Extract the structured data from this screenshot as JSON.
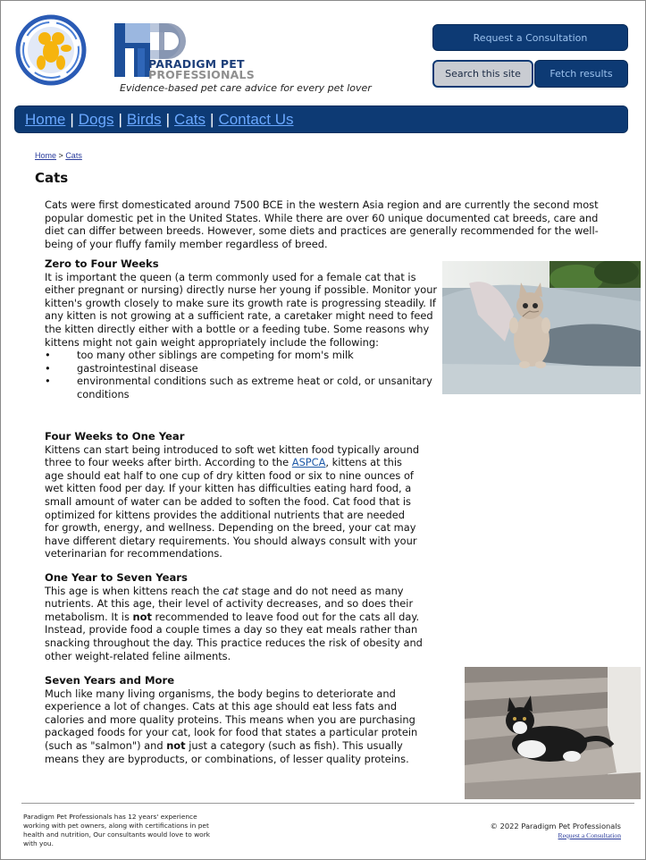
{
  "header": {
    "brand_line1": "PARADIGM PET",
    "brand_line2": "PROFESSIONALS",
    "tagline": "Evidence-based pet care advice for every pet lover",
    "request_consultation": "Request a Consultation",
    "search_label": "Search this site",
    "fetch_label": "Fetch results"
  },
  "nav": {
    "items": [
      {
        "label": "Home"
      },
      {
        "label": "Dogs"
      },
      {
        "label": "Birds"
      },
      {
        "label": "Cats"
      },
      {
        "label": "Contact Us"
      }
    ],
    "separator": "|"
  },
  "breadcrumb": {
    "home": "Home",
    "sep": ">",
    "current": "Cats"
  },
  "page": {
    "title": "Cats",
    "intro": "Cats were first domesticated around 7500 BCE in the western Asia region and are currently the second most popular domestic pet in the United States. While there are over 60 unique documented cat breeds, care and diet can differ between breeds. However, some diets and practices are generally recommended for the well-being of your fluffy family member regardless of breed.",
    "sections": [
      {
        "heading": "Zero to Four Weeks",
        "body": "It is important the queen (a term commonly used for a female cat that is either pregnant or nursing) directly nurse her young if possible. Monitor your kitten's growth closely to make sure its growth rate is progressing steadily. If any kitten is not growing at a sufficient rate, a caretaker might need to feed the kitten directly either with a bottle or a feeding tube. Some reasons why kittens might not gain weight appropriately include the following:",
        "bullets": [
          "too many other siblings are competing for mom's milk",
          "gastrointestinal disease",
          "environmental conditions such as extreme heat or cold, or unsanitary conditions"
        ]
      },
      {
        "heading": "Four Weeks to One Year",
        "body_pre": "Kittens can start being introduced to soft wet kitten food typically around three to four weeks after birth. According to the ",
        "link": "ASPCA",
        "body_post": ", kittens at this age should eat half to one cup of dry kitten food or six to nine ounces of wet kitten food per day. If your kitten has difficulties eating hard food, a small amount of water can be added to soften the food. Cat food that is optimized for kittens provides the additional nutrients that are needed for growth, energy, and wellness. Depending on the breed, your cat may have different dietary requirements. You should always consult with your veterinarian for recommendations."
      },
      {
        "heading": "One Year to Seven Years",
        "body_a": "This age is when kittens reach the ",
        "body_em": "cat",
        "body_b": " stage and do not need as many nutrients. At this age, their level of activity decreases, and so does their metabolism. It is ",
        "body_strong": "not",
        "body_c": " recommended to leave food out for the cats all day. Instead, provide food a couple times a day so they eat meals rather than snacking throughout the day. This practice reduces the risk of obesity and other weight-related feline ailments."
      },
      {
        "heading": "Seven Years and More",
        "body_a": "Much like many living organisms, the body begins to deteriorate and experience a lot of changes. Cats at this age should eat less fats and calories and more quality proteins. This means when you are purchasing packaged foods for your cat, look for food that states a particular protein (such as \"salmon\") and ",
        "body_strong": "not",
        "body_b": " just a category (such as fish). This usually means they are byproducts, or combinations, of lesser quality proteins."
      }
    ]
  },
  "footer": {
    "about": "Paradigm Pet Professionals has 12 years' experience working with pet owners, along with certifications in pet health and nutrition, Our consultants would love to work with you.",
    "copyright": "© 2022 Paradigm Pet Professionals",
    "consult_link": "Request a Consultation"
  },
  "colors": {
    "navy": "#0d3a74",
    "nav_link": "#6aa8ff",
    "button_text": "#9cc2ee"
  }
}
